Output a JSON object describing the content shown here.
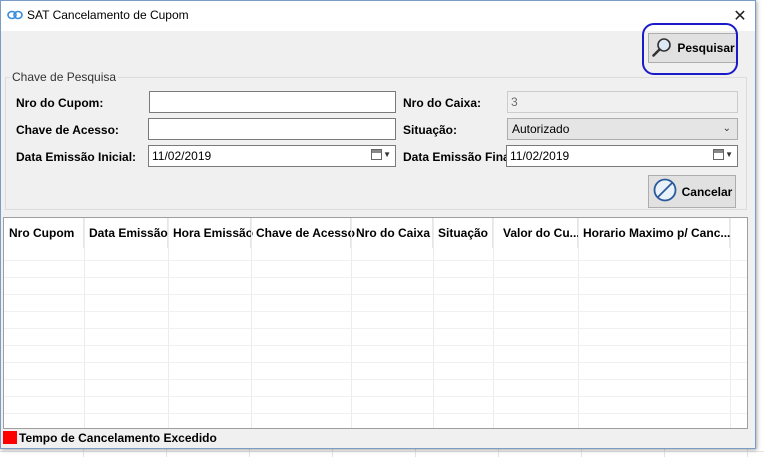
{
  "window": {
    "title": "SAT Cancelamento de Cupom",
    "close_glyph": "✕"
  },
  "toolbar": {
    "search_label": "Pesquisar"
  },
  "search_group": {
    "legend": "Chave de Pesquisa",
    "nro_cupom_label": "Nro do Cupom:",
    "nro_cupom_value": "",
    "chave_acesso_label": "Chave de Acesso:",
    "chave_acesso_value": "",
    "data_inicial_label": "Data Emissão Inicial:",
    "data_inicial_value": "11/02/2019",
    "nro_caixa_label": "Nro do Caixa:",
    "nro_caixa_value": "3",
    "situacao_label": "Situação:",
    "situacao_value": "Autorizado",
    "data_final_label": "Data Emissão Final:",
    "data_final_value": "11/02/2019",
    "cancel_label": "Cancelar"
  },
  "table": {
    "columns": [
      "Nro Cupom",
      "Data Emissão",
      "Hora Emissão",
      "Chave de Acesso",
      "Nro do Caixa",
      "Situação",
      "Valor do Cu...",
      "Horario Maximo p/ Canc..."
    ],
    "rows": []
  },
  "legend": {
    "text": "Tempo de Cancelamento Excedido",
    "color": "#ff0000"
  },
  "colors": {
    "highlight": "#1a1ac8"
  }
}
